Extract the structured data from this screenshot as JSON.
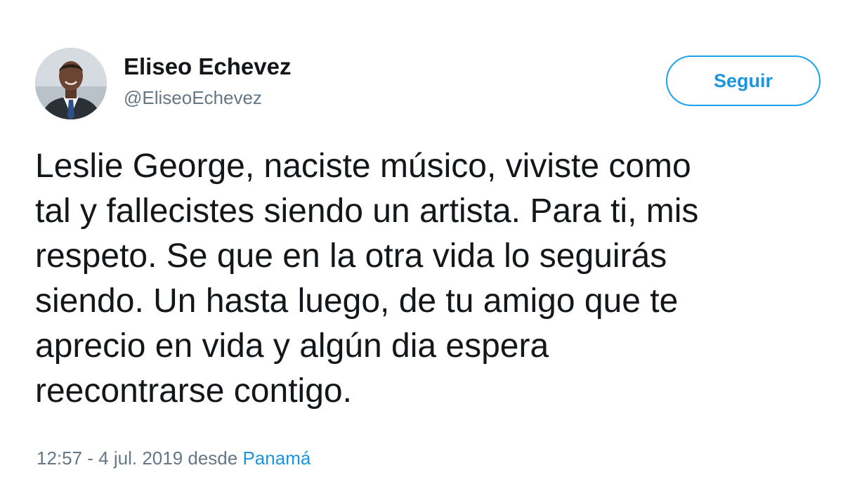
{
  "author": {
    "name": "Eliseo Echevez",
    "handle": "@EliseoEchevez",
    "avatar_icon": "profile-photo"
  },
  "follow_button": {
    "label": "Seguir",
    "color": "#1da1f2"
  },
  "tweet": {
    "lines": [
      "Leslie George, naciste músico, viviste como",
      "tal y fallecistes siendo un artista. Para ti, mis",
      "respeto. Se que en la otra vida lo seguirás",
      "siendo. Un hasta luego, de tu amigo que te",
      "aprecio en vida y algún dia espera",
      "reecontrarse contigo."
    ]
  },
  "meta": {
    "timestamp": "12:57 - 4 jul. 2019",
    "source_prefix": "desde",
    "location": "Panamá"
  }
}
